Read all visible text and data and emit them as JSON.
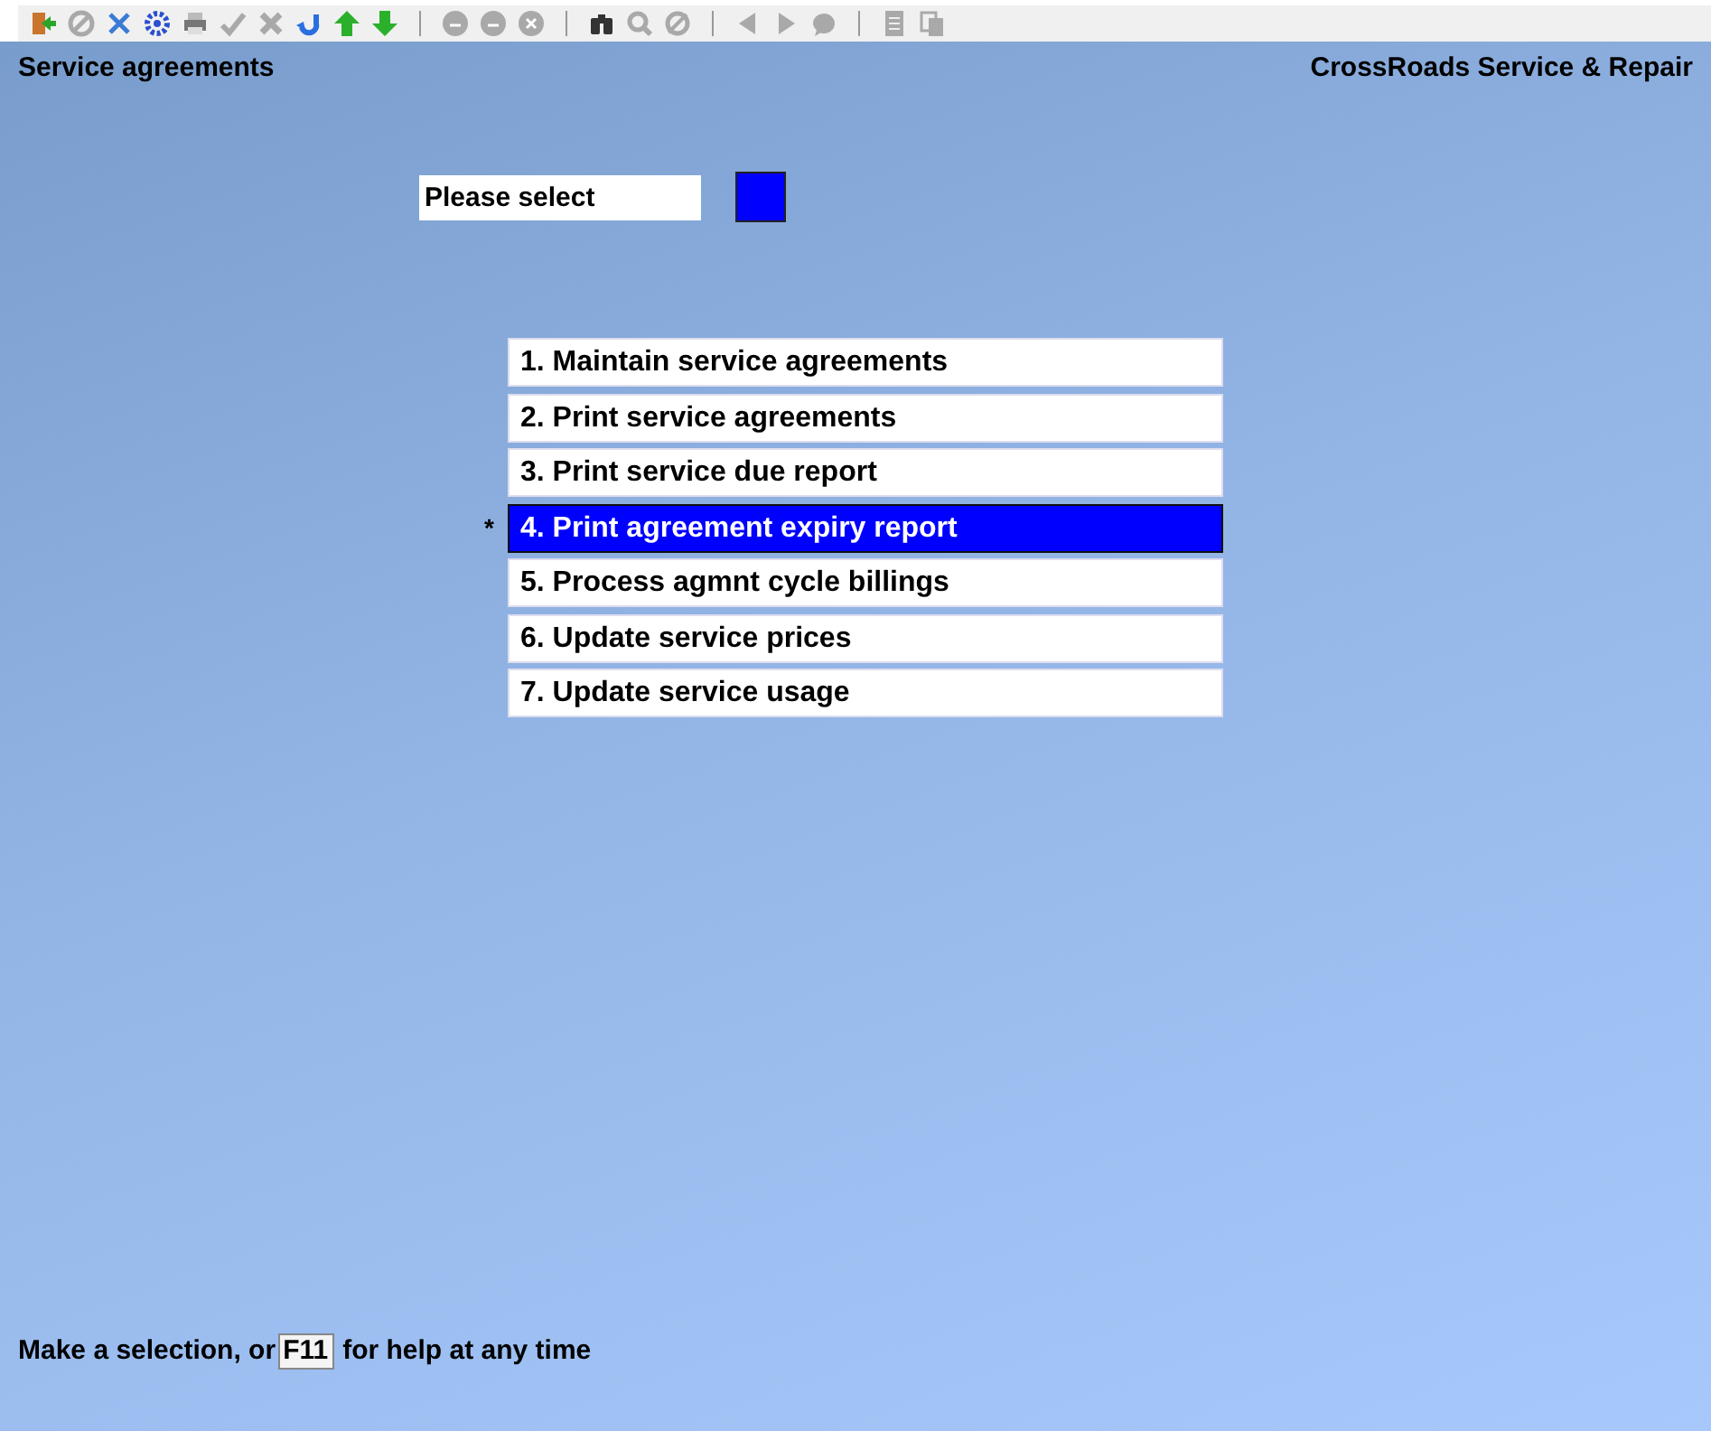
{
  "screen_title": "Service agreements",
  "company": "CrossRoads Service & Repair",
  "prompt": {
    "label": "Please select"
  },
  "menu": [
    {
      "label": "1. Maintain service agreements",
      "selected": false
    },
    {
      "label": "2. Print service agreements",
      "selected": false
    },
    {
      "label": "3. Print service due report",
      "selected": false
    },
    {
      "label": "4. Print agreement expiry report",
      "selected": true,
      "marker": "*"
    },
    {
      "label": "5. Process agmnt cycle billings",
      "selected": false
    },
    {
      "label": "6. Update service prices",
      "selected": false
    },
    {
      "label": "7. Update service usage",
      "selected": false
    }
  ],
  "status": {
    "before": "Make a selection, or",
    "key": "F11",
    "after": "for help at any time"
  }
}
